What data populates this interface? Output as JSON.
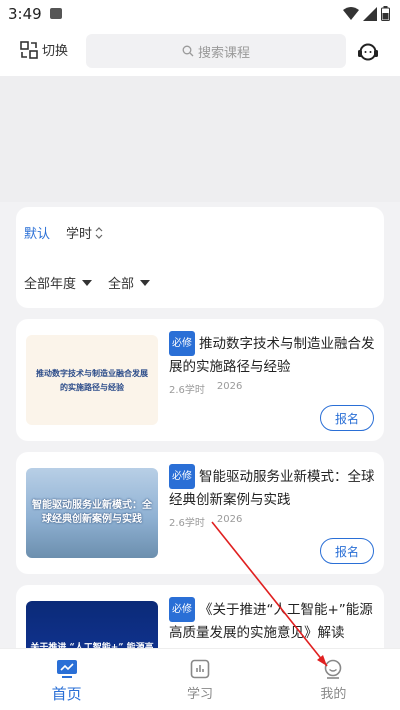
{
  "status": {
    "time": "3:49"
  },
  "header": {
    "switch_label": "切换",
    "search_placeholder": "搜索课程"
  },
  "filter": {
    "sort_default": "默认",
    "sort_hours": "学时",
    "year_filter": "全部年度",
    "type_filter": "全部"
  },
  "courses": [
    {
      "badge": "必修",
      "title": "推动数字技术与制造业融合发展的实施路径与经验",
      "thumb_text": "推动数字技术与制造业融合发展的实施路径与经验",
      "hours": "2.6学时",
      "year": "2026",
      "action": "报名"
    },
    {
      "badge": "必修",
      "title": "智能驱动服务业新模式：全球经典创新案例与实践",
      "thumb_text": "智能驱动服务业新模式：全球经典创新案例与实践",
      "hours": "2.6学时",
      "year": "2026",
      "action": "报名"
    },
    {
      "badge": "必修",
      "title": "《关于推进“人工智能+”能源高质量发展的实施意见》解读",
      "thumb_text": "关于推进 “人工智能+” 能源高",
      "hours": "",
      "year": "",
      "action": ""
    }
  ],
  "tabs": [
    {
      "label": "首页",
      "active": true
    },
    {
      "label": "学习",
      "active": false
    },
    {
      "label": "我的",
      "active": false
    }
  ],
  "colors": {
    "accent": "#2a6fd6",
    "annotation_arrow": "#e02020"
  }
}
